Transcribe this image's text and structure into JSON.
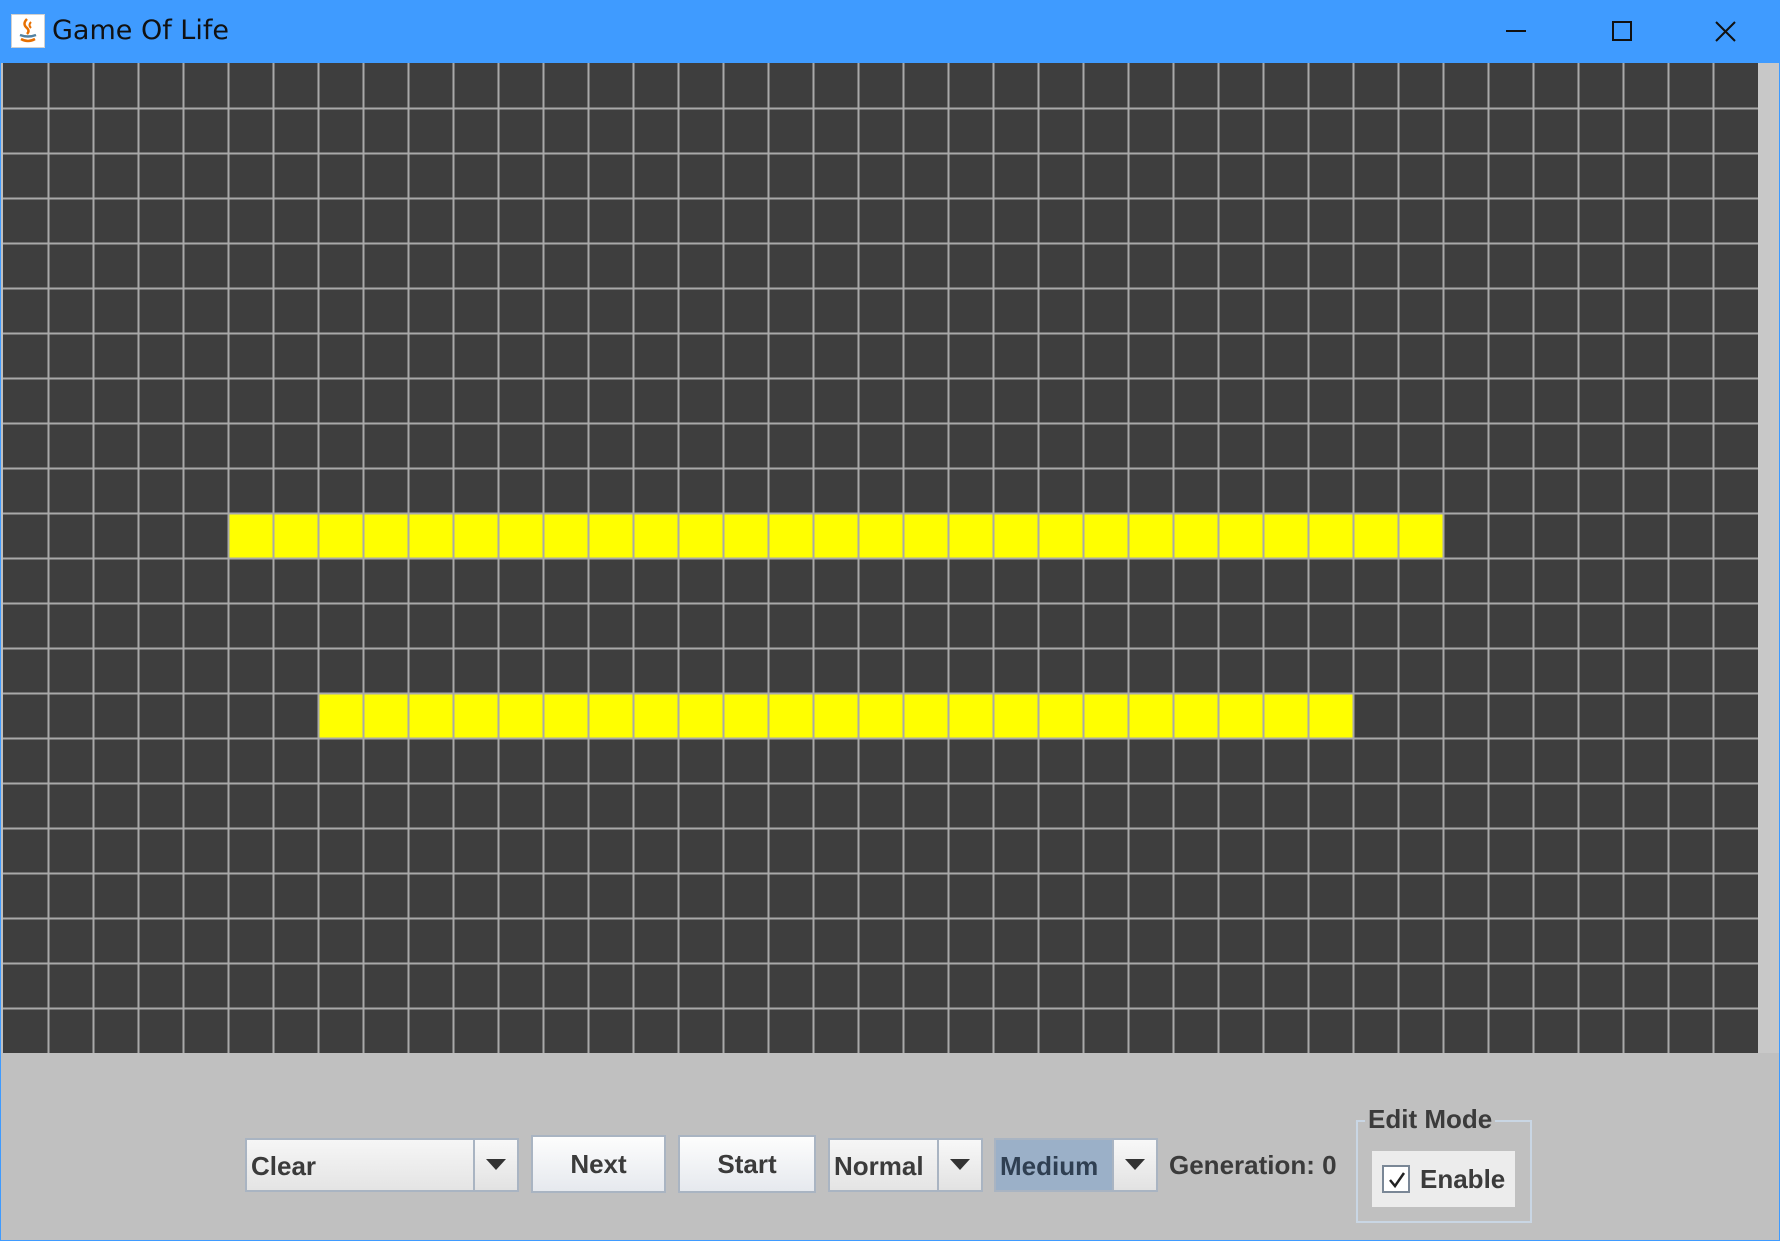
{
  "window": {
    "title": "Game Of Life",
    "titlebar_color": "#3f9bff",
    "icons": {
      "app": "java-icon",
      "minimize": "minimize-icon",
      "maximize": "maximize-icon",
      "close": "close-icon"
    }
  },
  "board": {
    "columns": 39,
    "rows": 22,
    "dead_color": "#3e3e3e",
    "live_color": "#ffff00",
    "grid_color": "#a9a9a9",
    "live_rows": [
      {
        "row": 10,
        "col_start": 5,
        "col_end": 31
      },
      {
        "row": 14,
        "col_start": 7,
        "col_end": 29
      }
    ]
  },
  "controls": {
    "pattern_select": {
      "value": "Clear"
    },
    "next_label": "Next",
    "start_label": "Start",
    "mode_select": {
      "value": "Normal"
    },
    "speed_select": {
      "value": "Medium"
    },
    "generation_text": "Generation: 0",
    "edit_mode": {
      "legend": "Edit Mode",
      "checkbox_label": "Enable",
      "checked": true
    }
  }
}
